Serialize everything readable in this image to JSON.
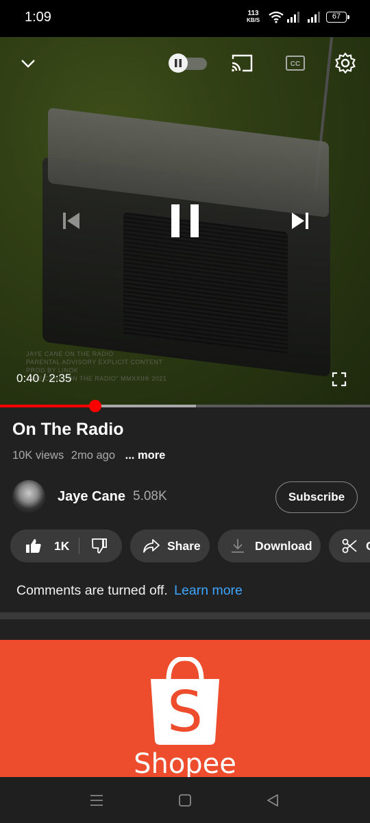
{
  "status_bar": {
    "time": "1:09",
    "net_speed": "113",
    "net_unit": "KB/S",
    "battery": "67"
  },
  "player": {
    "current_time": "0:40",
    "separator": "/",
    "duration": "2:35",
    "progress_fraction": 0.258,
    "buffered_fraction": 0.53,
    "cover_lines": [
      "JAYE CANE                     ON THE RADIO",
      "PARENTAL   ADVISORY   EXPLICIT   CONTENT",
      "PROD          BY                       LINOK",
      "JAYE CANE \"ON THE RADIO\" MMXXII® 2021"
    ]
  },
  "video": {
    "title": "On The Radio",
    "views": "10K views",
    "age": "2mo ago",
    "more": "... more"
  },
  "channel": {
    "name": "Jaye Cane",
    "subscribers": "5.08K",
    "subscribe_label": "Subscribe"
  },
  "actions": {
    "like_count": "1K",
    "share_label": "Share",
    "download_label": "Download",
    "clip_label": "C"
  },
  "comments": {
    "text": "Comments are turned off.",
    "link": "Learn more"
  },
  "ad": {
    "brand": "Shopee",
    "color": "#ee4d2d"
  },
  "colors": {
    "progress": "#ff0000",
    "link": "#3ea6ff",
    "background": "#212121"
  }
}
